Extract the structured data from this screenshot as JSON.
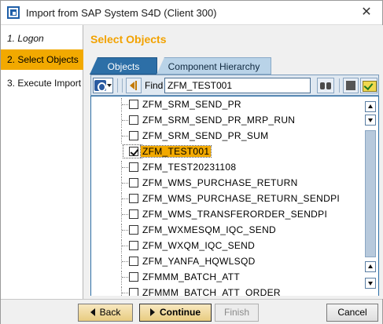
{
  "window": {
    "title": "Import from SAP System S4D (Client 300)",
    "close_glyph": "✕"
  },
  "steps": [
    {
      "label": "1. Logon",
      "state": "done"
    },
    {
      "label": "2. Select Objects",
      "state": "active"
    },
    {
      "label": "3. Execute Import",
      "state": "pending"
    }
  ],
  "main": {
    "section_title": "Select Objects",
    "tabs": [
      {
        "label": "Objects",
        "active": true
      },
      {
        "label": "Component Hierarchy",
        "active": false
      }
    ],
    "toolbar": {
      "find_label": "Find",
      "find_value": "ZFM_TEST001",
      "icons": [
        "tree-refresh-icon",
        "find-previous-icon",
        "binoculars-icon",
        "stop-icon",
        "select-check-icon"
      ]
    },
    "list": [
      {
        "label": "ZFM_SRM_SEND_PR",
        "checked": false
      },
      {
        "label": "ZFM_SRM_SEND_PR_MRP_RUN",
        "checked": false
      },
      {
        "label": "ZFM_SRM_SEND_PR_SUM",
        "checked": false
      },
      {
        "label": "ZFM_TEST001",
        "checked": true,
        "selected": true
      },
      {
        "label": "ZFM_TEST20231108",
        "checked": false
      },
      {
        "label": "ZFM_WMS_PURCHASE_RETURN",
        "checked": false
      },
      {
        "label": "ZFM_WMS_PURCHASE_RETURN_SENDPI",
        "checked": false
      },
      {
        "label": "ZFM_WMS_TRANSFERORDER_SENDPI",
        "checked": false
      },
      {
        "label": "ZFM_WXMESQM_IQC_SEND",
        "checked": false
      },
      {
        "label": "ZFM_WXQM_IQC_SEND",
        "checked": false
      },
      {
        "label": "ZFM_YANFA_HQWLSQD",
        "checked": false
      },
      {
        "label": "ZFMMM_BATCH_ATT",
        "checked": false
      },
      {
        "label": "ZFMMM_BATCH_ATT_ORDER",
        "checked": false
      }
    ]
  },
  "buttons": {
    "back": "Back",
    "continue": "Continue",
    "finish": "Finish",
    "cancel": "Cancel"
  },
  "colors": {
    "accent": "#f2a900",
    "tab_active": "#2d6fa7",
    "tab_inactive": "#b9d3e8"
  }
}
